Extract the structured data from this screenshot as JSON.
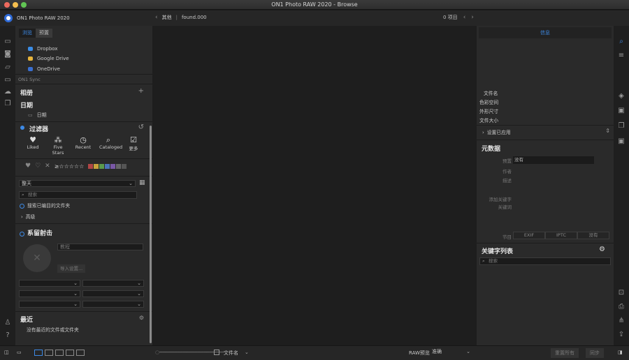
{
  "window_title": "ON1 Photo RAW 2020 - Browse",
  "app_name": "ON1 Photo RAW 2020",
  "breadcrumb": {
    "back_label": "其他",
    "current": "found.000"
  },
  "item_count": "0 项目",
  "left_tabs": [
    "浏览",
    "预置"
  ],
  "sources": [
    {
      "label": "Dropbox",
      "color": "#3b8de6"
    },
    {
      "label": "Google Drive",
      "color": "#e8b53c"
    },
    {
      "label": "OneDrive",
      "color": "#3a6fd0"
    }
  ],
  "sync_label": "ON1 Sync",
  "albums_header": "相册",
  "dates_header": "日期",
  "dates_item": "日期",
  "filters": {
    "header": "过滤器",
    "buttons": [
      {
        "label": "Liked",
        "icon": "heart-icon"
      },
      {
        "label": "Five Stars",
        "icon": "stars-icon"
      },
      {
        "label": "Recent",
        "icon": "clock-icon"
      },
      {
        "label": "Cataloged",
        "icon": "folder-search-icon"
      },
      {
        "label": "更多",
        "icon": "checkbox-icon"
      }
    ],
    "rating_text": "≥☆☆☆☆☆",
    "swatches": [
      "#b04545",
      "#c8a23c",
      "#5a9a4c",
      "#4a72b8",
      "#7a58a6",
      "#666666",
      "#555555"
    ],
    "date_option": "整天",
    "search_placeholder": "搜索",
    "search_cataloged": "搜索已编目的文件夹",
    "advanced": "高级"
  },
  "people": {
    "header": "系留射击",
    "field_placeholder": "教程",
    "import_label": "导入设置..."
  },
  "recent": {
    "header": "最近",
    "empty": "没有最近的文件或文件夹"
  },
  "right": {
    "tab": "信息",
    "file_info": [
      "文件名",
      "色彩空间",
      "外形尺寸",
      "文件大小"
    ],
    "settings_applied": "设置已应用",
    "metadata_header": "元数据",
    "preset_label": "预置",
    "preset_value": "没有",
    "author_label": "作者",
    "description_label": "描述",
    "add_keyword_label": "添加关键字",
    "keywords_label": "关键词",
    "section_label": "节目",
    "section_tabs": [
      "EXIF",
      "IPTC",
      "没有"
    ],
    "keyword_list_header": "关键字列表",
    "keyword_search_placeholder": "搜索"
  },
  "bottom": {
    "sort_label": "文件名",
    "raw_label": "RAW预览",
    "raw_value": "准确",
    "reset_all": "重置所有",
    "sync": "同步"
  }
}
